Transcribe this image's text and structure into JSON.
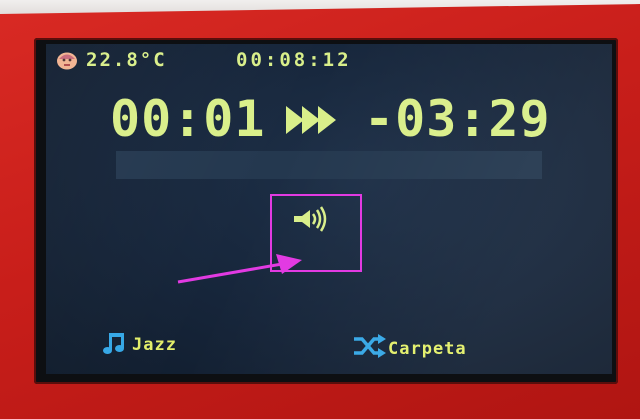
{
  "status_bar": {
    "temperature": "22.8°C",
    "clock": "00:08:12"
  },
  "playback": {
    "elapsed": "00:01",
    "remaining": "-03:29",
    "mode_icon": "fast-forward-icon",
    "progress": 0.0
  },
  "volume": {
    "icon": "speaker-volume-icon"
  },
  "footer": {
    "playlist_icon": "music-note-icon",
    "playlist_label": "Jazz",
    "folder_icon": "shuffle-icon",
    "folder_label": "Carpeta"
  },
  "annotation": {
    "highlight_color": "#e23ae2"
  },
  "colors": {
    "lcd_text": "#d9ef8a",
    "footer_text": "#e3ef6a",
    "progress_fill": "#a8dbe4",
    "screen_bg": "#1a2a40",
    "accent_icon": "#35a7e6",
    "case": "#c81e1a"
  }
}
